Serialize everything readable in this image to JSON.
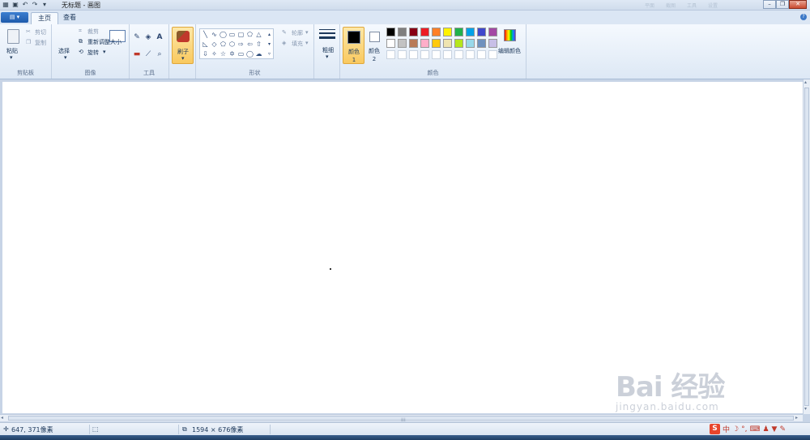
{
  "window": {
    "title": "无标题 - 画图",
    "title_bar_faded": [
      "平面",
      "截图",
      "工具",
      "设置"
    ]
  },
  "tabs": [
    {
      "label": "主页",
      "active": true
    },
    {
      "label": "查看",
      "active": false
    }
  ],
  "ribbon": {
    "clipboard": {
      "group_label": "剪贴板",
      "paste": "粘贴",
      "cut": "剪切",
      "copy": "复制"
    },
    "image": {
      "group_label": "图像",
      "select": "选择",
      "crop": "裁剪",
      "resize": "重新调整大小",
      "rotate": "旋转"
    },
    "tools": {
      "group_label": "工具",
      "text_tool": "A"
    },
    "brushes": {
      "label": "刷子"
    },
    "shapes": {
      "group_label": "形状",
      "outline": "轮廓",
      "fill": "填充"
    },
    "size": {
      "label": "粗细"
    },
    "colors": {
      "group_label": "颜色",
      "color1_label": "颜色 1",
      "color2_label": "颜色 2",
      "color1_value": "#000000",
      "color2_value": "#ffffff",
      "edit_colors": "编辑颜色",
      "palette_row1": [
        "#000000",
        "#7f7f7f",
        "#880015",
        "#ed1c24",
        "#ff7f27",
        "#fff200",
        "#22b14c",
        "#00a2e8",
        "#3f48cc",
        "#a349a4"
      ],
      "palette_row2": [
        "#ffffff",
        "#c3c3c3",
        "#b97a57",
        "#ffaec9",
        "#ffc90e",
        "#efe4b0",
        "#b5e61d",
        "#99d9ea",
        "#7092be",
        "#c8bfe7"
      ],
      "palette_row3_empty": 10
    }
  },
  "status": {
    "cursor_position": "647, 371像素",
    "canvas_size": "1594 × 676像素"
  },
  "watermark": {
    "brand": "Bai  经验",
    "url": "jingyan.baidu.com"
  },
  "tray_icons": [
    "S",
    "中",
    "moon-icon",
    "dots-icon",
    "keyboard-icon",
    "user-icon",
    "shirt-icon",
    "wrench-icon"
  ]
}
